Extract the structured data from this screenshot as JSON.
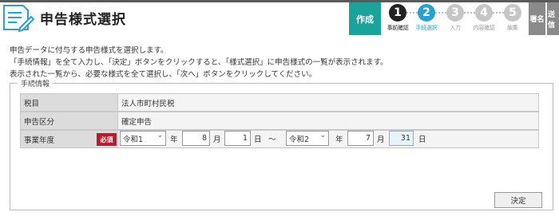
{
  "header": {
    "title": "申告様式選択"
  },
  "steps": {
    "create_label": "作成",
    "items": [
      {
        "number": "1",
        "label": "事前確認",
        "status": "done"
      },
      {
        "number": "2",
        "label": "手続選択",
        "status": "current"
      },
      {
        "number": "3",
        "label": "入力",
        "status": "todo"
      },
      {
        "number": "4",
        "label": "内容確認",
        "status": "todo"
      },
      {
        "number": "5",
        "label": "編集",
        "status": "todo"
      }
    ],
    "sign_label": "署名",
    "send_label": "送信"
  },
  "description": {
    "line1": "申告データに付与する申告様式を選択します。",
    "line2": "「手続情報」を全て入力し、「決定」ボタンをクリックすると、「様式選択」に申告様式の一覧が表示されます。",
    "line3": "表示された一覧から、必要な様式を全て選択し、「次へ」ボタンをクリックしてください。"
  },
  "procedure": {
    "legend": "手続情報",
    "tax_item_label": "税目",
    "tax_item_value": "法人市町村民税",
    "declaration_type_label": "申告区分",
    "declaration_type_value": "確定申告",
    "fiscal_year_label": "事業年度",
    "required_badge": "必須",
    "start": {
      "era": "令和1",
      "year": "8",
      "month": "1"
    },
    "end": {
      "era": "令和2",
      "year": "7",
      "month": "31"
    },
    "unit_year": "年",
    "unit_month": "月",
    "unit_day": "日",
    "range_sep": "〜"
  },
  "actions": {
    "decide_label": "決定"
  },
  "colors": {
    "accent": "#1aa39a",
    "current_step": "#2aa0d0",
    "required": "#c4162e"
  }
}
